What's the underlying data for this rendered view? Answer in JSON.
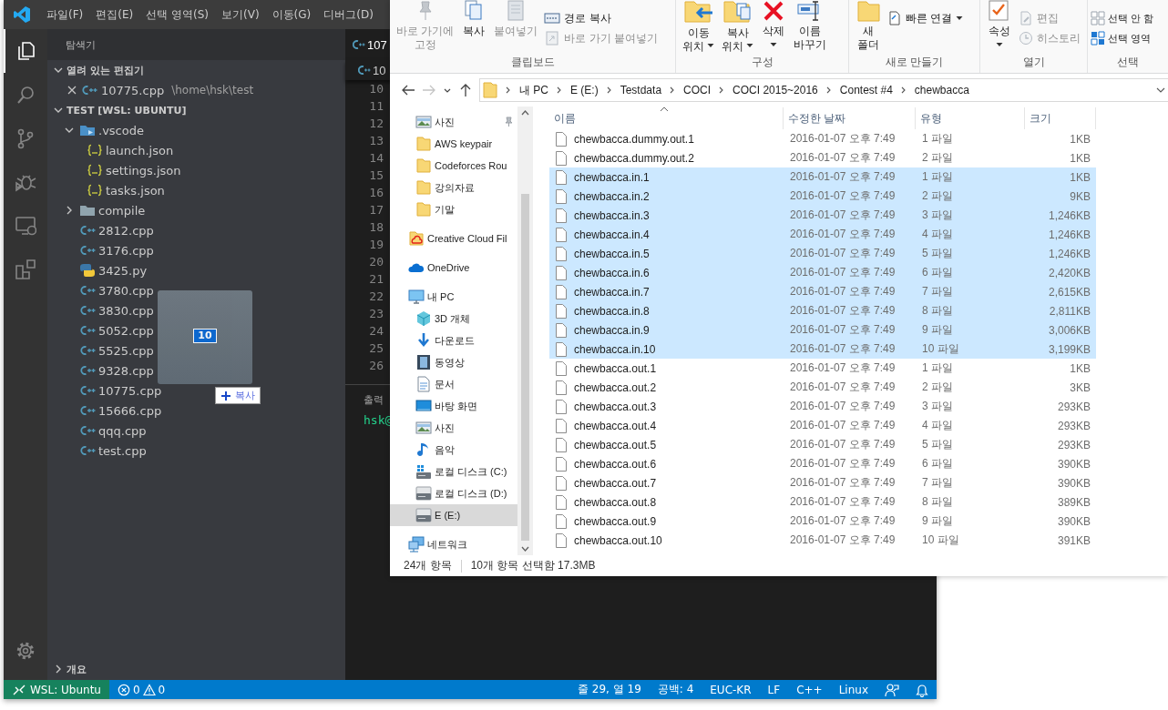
{
  "vscode": {
    "menu": [
      "파일(F)",
      "편집(E)",
      "선택 영역(S)",
      "보기(V)",
      "이동(G)",
      "디버그(D)"
    ],
    "activity": [
      {
        "kind": "explorer",
        "selected": true
      },
      {
        "kind": "search",
        "selected": false
      },
      {
        "kind": "source-control",
        "selected": false
      },
      {
        "kind": "debug",
        "selected": false
      },
      {
        "kind": "remote",
        "selected": false
      },
      {
        "kind": "extensions",
        "selected": false
      },
      {
        "kind": "settings",
        "selected": false
      }
    ],
    "sidebar": {
      "title": "탐색기",
      "open_editors": {
        "label": "열려 있는 편집기",
        "expanded": true,
        "items": [
          {
            "name": "10775.cpp",
            "path": "\\home\\hsk\\test"
          }
        ]
      },
      "folder": {
        "label": "TEST [WSL: UBUNTU]",
        "expanded": true,
        "tree": [
          {
            "kind": "vscode-folder",
            "name": ".vscode",
            "expanded": true,
            "children": [
              {
                "kind": "json",
                "name": "launch.json"
              },
              {
                "kind": "json",
                "name": "settings.json"
              },
              {
                "kind": "json",
                "name": "tasks.json"
              }
            ]
          },
          {
            "kind": "folder",
            "name": "compile",
            "expanded": false
          },
          {
            "kind": "cpp",
            "name": "2812.cpp"
          },
          {
            "kind": "cpp",
            "name": "3176.cpp"
          },
          {
            "kind": "python",
            "name": "3425.py"
          },
          {
            "kind": "cpp",
            "name": "3780.cpp"
          },
          {
            "kind": "cpp",
            "name": "3830.cpp"
          },
          {
            "kind": "cpp",
            "name": "5052.cpp"
          },
          {
            "kind": "cpp",
            "name": "5525.cpp"
          },
          {
            "kind": "cpp",
            "name": "9328.cpp"
          },
          {
            "kind": "cpp",
            "name": "10775.cpp"
          },
          {
            "kind": "cpp",
            "name": "15666.cpp"
          },
          {
            "kind": "cpp",
            "name": "qqq.cpp"
          },
          {
            "kind": "cpp",
            "name": "test.cpp"
          }
        ]
      },
      "outline": {
        "label": "개요",
        "expanded": false
      }
    },
    "editor": {
      "tab": "107",
      "breadcrumb": "10",
      "line_numbers": [
        "10",
        "11",
        "12",
        "13",
        "14",
        "15",
        "16",
        "17",
        "18",
        "19",
        "20",
        "21",
        "22",
        "23",
        "24",
        "25",
        "26"
      ],
      "panel_tab": "출력",
      "terminal_text": "hsk@"
    },
    "drag": {
      "count": "10",
      "label": "복사"
    },
    "status_bar": {
      "remote": "WSL: Ubuntu",
      "errors": "0",
      "warnings": "0",
      "items": [
        "줄 29, 열 19",
        "공백: 4",
        "EUC-KR",
        "LF",
        "C++",
        "Linux"
      ]
    }
  },
  "file_explorer": {
    "ribbon": [
      {
        "label": "클립보드",
        "items": [
          {
            "kind": "pin",
            "label": "바로 가기에\n고정",
            "disabled": true
          },
          {
            "kind": "copy",
            "label": "복사",
            "disabled": false
          },
          {
            "kind": "paste",
            "label": "붙여넣기",
            "disabled": true
          },
          {
            "kind": "stack",
            "items": [
              {
                "kind": "copy-path",
                "label": "경로 복사",
                "disabled": false
              },
              {
                "kind": "paste-shortcut",
                "label": "바로 가기 붙여넣기",
                "disabled": true
              }
            ]
          }
        ]
      },
      {
        "label": "구성",
        "items": [
          {
            "kind": "move",
            "label": "이동\n위치",
            "disabled": false,
            "menu": true
          },
          {
            "kind": "copy-to",
            "label": "복사\n위치",
            "disabled": false,
            "menu": true
          },
          {
            "kind": "delete",
            "label": "삭제",
            "disabled": false,
            "menu": true
          },
          {
            "kind": "rename",
            "label": "이름\n바꾸기",
            "disabled": false
          }
        ]
      },
      {
        "label": "새로 만들기",
        "items": [
          {
            "kind": "new-folder",
            "label": "새\n폴더",
            "disabled": false
          },
          {
            "kind": "stack",
            "items": [
              {
                "kind": "easy-access",
                "label": "빠른 연결",
                "disabled": false,
                "menu": true
              }
            ]
          }
        ]
      },
      {
        "label": "열기",
        "items": [
          {
            "kind": "properties",
            "label": "속성",
            "disabled": false,
            "menu": true
          },
          {
            "kind": "stack",
            "items": [
              {
                "kind": "edit",
                "label": "편집",
                "disabled": true
              },
              {
                "kind": "history",
                "label": "히스토리",
                "disabled": true
              }
            ]
          }
        ]
      },
      {
        "label": "선택",
        "items": [
          {
            "kind": "stack",
            "items": [
              {
                "kind": "select-none",
                "label": "선택 안 함",
                "disabled": false
              },
              {
                "kind": "invert",
                "label": "선택 영역",
                "disabled": false
              }
            ]
          }
        ]
      }
    ],
    "address": [
      "내 PC",
      "E (E:)",
      "Testdata",
      "COCI",
      "COCI 2015~2016",
      "Contest #4",
      "chewbacca"
    ],
    "quick_access": [
      {
        "kind": "pictures",
        "label": "사진",
        "pinned": true
      },
      {
        "kind": "folder",
        "label": "AWS keypair",
        "pinned": false
      },
      {
        "kind": "folder",
        "label": "Codeforces Rou",
        "pinned": false
      },
      {
        "kind": "folder",
        "label": "강의자료",
        "pinned": false
      },
      {
        "kind": "folder",
        "label": "기말",
        "pinned": false
      }
    ],
    "nav": [
      {
        "kind": "creative-cloud",
        "label": "Creative Cloud Fil",
        "selected": false
      },
      {
        "kind": "cloud",
        "label": "OneDrive",
        "selected": false
      },
      {
        "kind": "pc",
        "label": "내 PC",
        "selected": false,
        "children": [
          {
            "kind": "cube",
            "label": "3D 개체",
            "selected": false
          },
          {
            "kind": "download",
            "label": "다운로드",
            "selected": false
          },
          {
            "kind": "video",
            "label": "동영상",
            "selected": false
          },
          {
            "kind": "document",
            "label": "문서",
            "selected": false
          },
          {
            "kind": "desktop",
            "label": "바탕 화면",
            "selected": false
          },
          {
            "kind": "pictures",
            "label": "사진",
            "selected": false
          },
          {
            "kind": "music",
            "label": "음악",
            "selected": false
          },
          {
            "kind": "system-drive",
            "label": "로컬 디스크 (C:)",
            "selected": false
          },
          {
            "kind": "drive",
            "label": "로컬 디스크 (D:)",
            "selected": false
          },
          {
            "kind": "drive",
            "label": "E (E:)",
            "selected": true
          }
        ]
      },
      {
        "kind": "network",
        "label": "네트워크",
        "selected": false
      }
    ],
    "columns": [
      "이름",
      "수정한 날짜",
      "유형",
      "크기"
    ],
    "files": [
      {
        "name": "chewbacca.dummy.out.1",
        "date": "2016-01-07 오후 7:49",
        "type": "1 파일",
        "size": "1KB",
        "selected": false
      },
      {
        "name": "chewbacca.dummy.out.2",
        "date": "2016-01-07 오후 7:49",
        "type": "2 파일",
        "size": "1KB",
        "selected": false
      },
      {
        "name": "chewbacca.in.1",
        "date": "2016-01-07 오후 7:49",
        "type": "1 파일",
        "size": "1KB",
        "selected": true
      },
      {
        "name": "chewbacca.in.2",
        "date": "2016-01-07 오후 7:49",
        "type": "2 파일",
        "size": "9KB",
        "selected": true
      },
      {
        "name": "chewbacca.in.3",
        "date": "2016-01-07 오후 7:49",
        "type": "3 파일",
        "size": "1,246KB",
        "selected": true
      },
      {
        "name": "chewbacca.in.4",
        "date": "2016-01-07 오후 7:49",
        "type": "4 파일",
        "size": "1,246KB",
        "selected": true
      },
      {
        "name": "chewbacca.in.5",
        "date": "2016-01-07 오후 7:49",
        "type": "5 파일",
        "size": "1,246KB",
        "selected": true
      },
      {
        "name": "chewbacca.in.6",
        "date": "2016-01-07 오후 7:49",
        "type": "6 파일",
        "size": "2,420KB",
        "selected": true
      },
      {
        "name": "chewbacca.in.7",
        "date": "2016-01-07 오후 7:49",
        "type": "7 파일",
        "size": "2,615KB",
        "selected": true
      },
      {
        "name": "chewbacca.in.8",
        "date": "2016-01-07 오후 7:49",
        "type": "8 파일",
        "size": "2,811KB",
        "selected": true
      },
      {
        "name": "chewbacca.in.9",
        "date": "2016-01-07 오후 7:49",
        "type": "9 파일",
        "size": "3,006KB",
        "selected": true
      },
      {
        "name": "chewbacca.in.10",
        "date": "2016-01-07 오후 7:49",
        "type": "10 파일",
        "size": "3,199KB",
        "selected": true
      },
      {
        "name": "chewbacca.out.1",
        "date": "2016-01-07 오후 7:49",
        "type": "1 파일",
        "size": "1KB",
        "selected": false
      },
      {
        "name": "chewbacca.out.2",
        "date": "2016-01-07 오후 7:49",
        "type": "2 파일",
        "size": "3KB",
        "selected": false
      },
      {
        "name": "chewbacca.out.3",
        "date": "2016-01-07 오후 7:49",
        "type": "3 파일",
        "size": "293KB",
        "selected": false
      },
      {
        "name": "chewbacca.out.4",
        "date": "2016-01-07 오후 7:49",
        "type": "4 파일",
        "size": "293KB",
        "selected": false
      },
      {
        "name": "chewbacca.out.5",
        "date": "2016-01-07 오후 7:49",
        "type": "5 파일",
        "size": "293KB",
        "selected": false
      },
      {
        "name": "chewbacca.out.6",
        "date": "2016-01-07 오후 7:49",
        "type": "6 파일",
        "size": "390KB",
        "selected": false
      },
      {
        "name": "chewbacca.out.7",
        "date": "2016-01-07 오후 7:49",
        "type": "7 파일",
        "size": "390KB",
        "selected": false
      },
      {
        "name": "chewbacca.out.8",
        "date": "2016-01-07 오후 7:49",
        "type": "8 파일",
        "size": "389KB",
        "selected": false
      },
      {
        "name": "chewbacca.out.9",
        "date": "2016-01-07 오후 7:49",
        "type": "9 파일",
        "size": "390KB",
        "selected": false
      },
      {
        "name": "chewbacca.out.10",
        "date": "2016-01-07 오후 7:49",
        "type": "10 파일",
        "size": "391KB",
        "selected": false
      }
    ],
    "status": [
      "24개 항목",
      "10개 항목 선택함 17.3MB"
    ]
  }
}
